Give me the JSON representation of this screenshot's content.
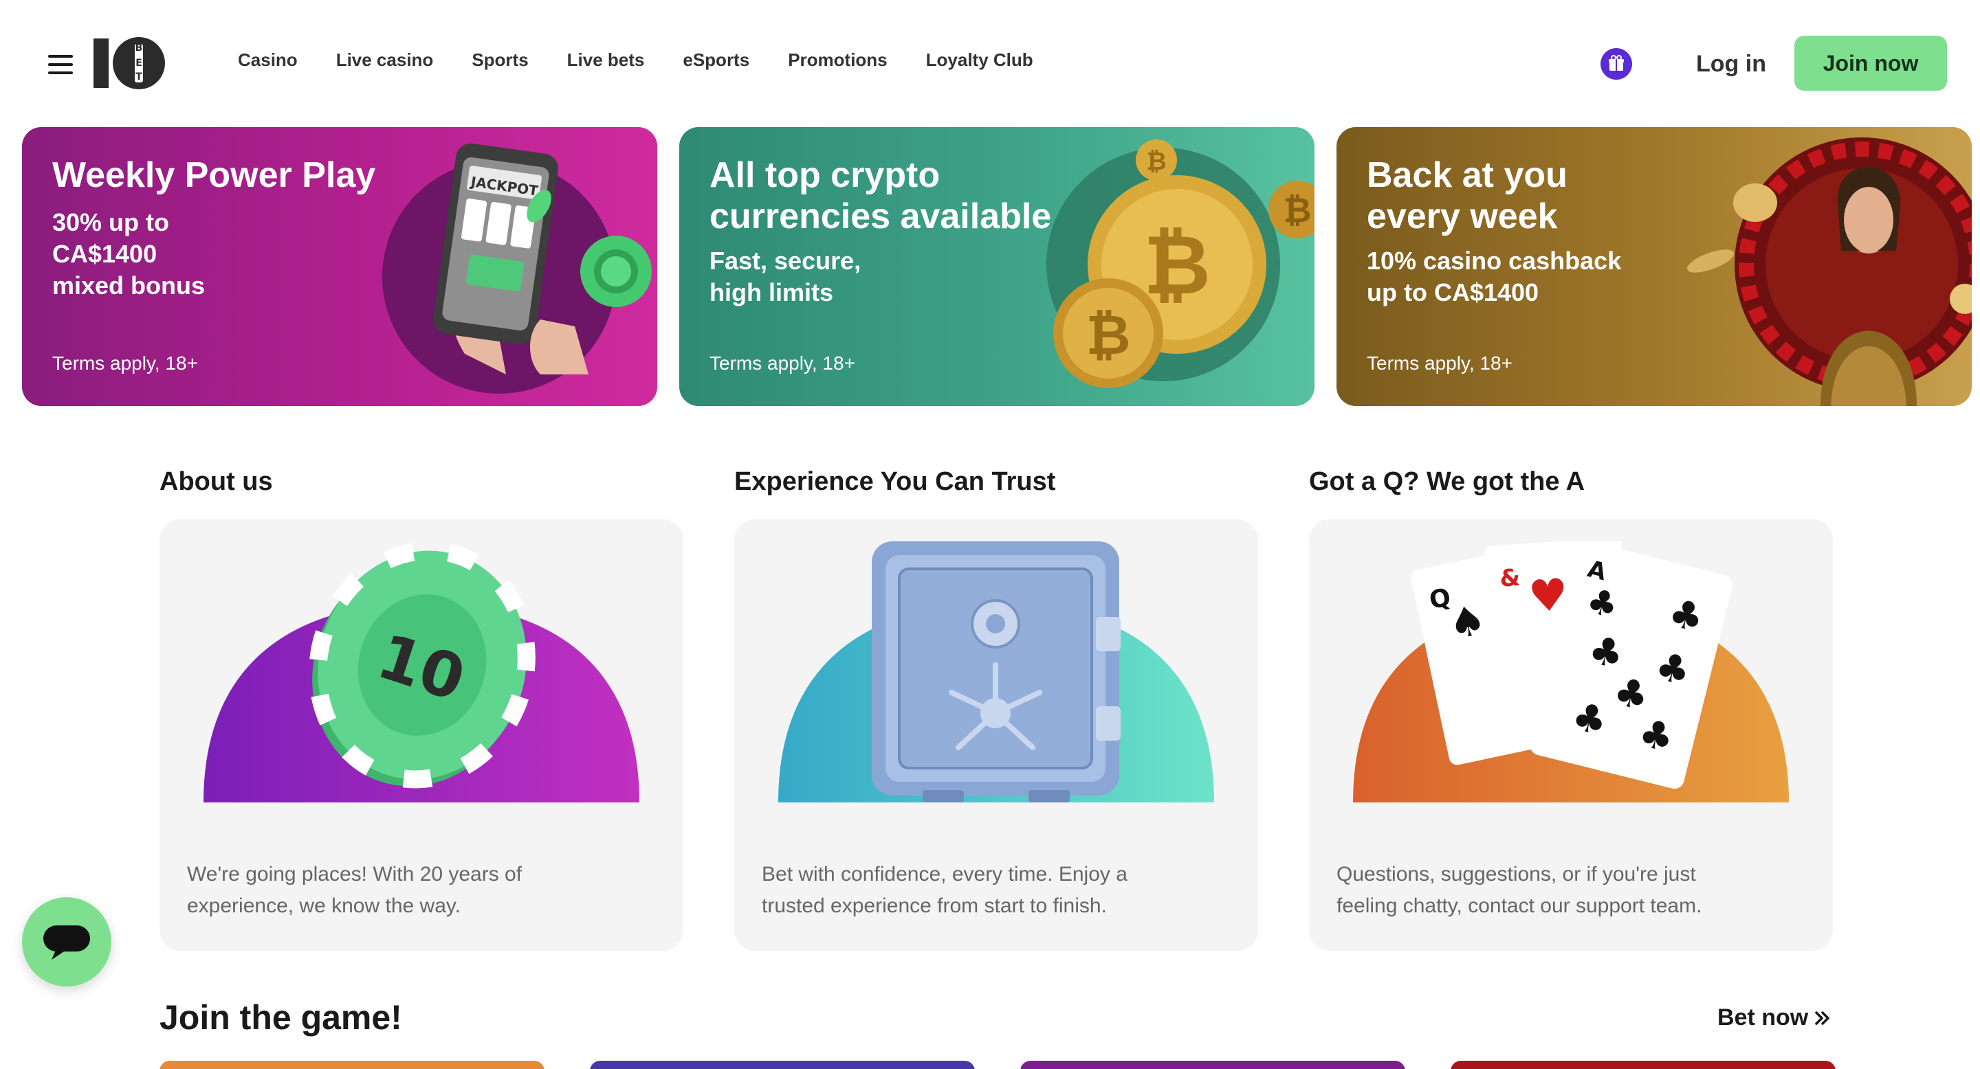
{
  "header": {
    "menu_icon": "hamburger-menu-icon",
    "logo_text": "10BET",
    "nav": [
      {
        "label": "Casino"
      },
      {
        "label": "Live casino"
      },
      {
        "label": "Sports"
      },
      {
        "label": "Live bets"
      },
      {
        "label": "eSports"
      },
      {
        "label": "Promotions"
      },
      {
        "label": "Loyalty Club"
      }
    ],
    "gift_icon": "gift-icon",
    "login_label": "Log in",
    "join_label": "Join now",
    "colors": {
      "join_bg": "#7ee08f",
      "gift_bg": "#5b2bd6"
    }
  },
  "banners": [
    {
      "title": "Weekly Power Play",
      "subtitle_lines": [
        "30% up to",
        "CA$1400",
        "mixed bonus"
      ],
      "terms": "Terms apply, 18+",
      "art": "phone-slot-machine-art",
      "art_text": "JACKPOT",
      "color": "#b4208f"
    },
    {
      "title_lines": [
        "All top crypto",
        "currencies available"
      ],
      "subtitle_lines": [
        "Fast, secure,",
        "high limits"
      ],
      "terms": "Terms apply, 18+",
      "art": "bitcoin-coins-art",
      "color": "#3fa489"
    },
    {
      "title_lines": [
        "Back at you",
        "every week"
      ],
      "subtitle_lines": [
        "10% casino cashback",
        "up to CA$1400"
      ],
      "terms": "Terms apply, 18+",
      "art": "roulette-dealer-art",
      "color": "#a47a2b"
    }
  ],
  "info_cards": [
    {
      "heading": "About us",
      "description": "We're going places! With 20 years of experience, we know the way.",
      "illustration": "casino-chip-illustration"
    },
    {
      "heading": "Experience You Can Trust",
      "description": "Bet with confidence, every time. Enjoy a trusted experience from start to finish.",
      "illustration": "safe-vault-illustration"
    },
    {
      "heading": "Got a Q? We got the A",
      "description": "Questions, suggestions, or if you're just feeling chatty, contact our support team.",
      "illustration": "playing-cards-illustration"
    }
  ],
  "join_section": {
    "title": "Join the game!",
    "bet_now_label": "Bet now",
    "bet_now_icon": "double-chevron-right-icon"
  },
  "chat": {
    "icon": "chat-bubble-icon"
  }
}
